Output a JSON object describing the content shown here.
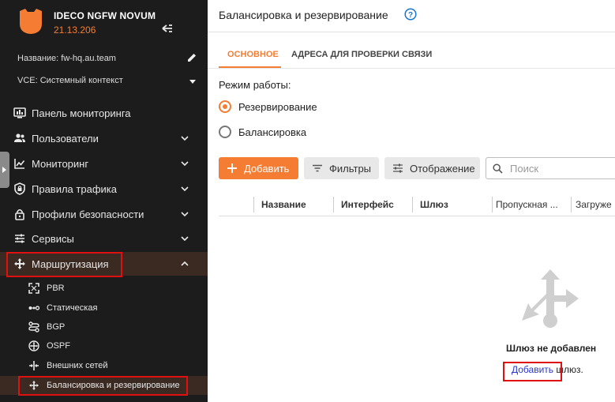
{
  "app": {
    "name": "IDECO NGFW NOVUM",
    "version": "21.13.206",
    "accent_color": "#f47d33",
    "sidebar_bg": "#1c1c1c"
  },
  "sidebar": {
    "name_label": "Название: fw-hq.au.team",
    "vce_label": "VCE: Системный контекст",
    "items": [
      {
        "label": "Панель мониторинга",
        "icon": "monitor-icon"
      },
      {
        "label": "Пользователи",
        "icon": "users-icon"
      },
      {
        "label": "Мониторинг",
        "icon": "chart-icon"
      },
      {
        "label": "Правила трафика",
        "icon": "shield-icon"
      },
      {
        "label": "Профили безопасности",
        "icon": "lock-icon"
      },
      {
        "label": "Сервисы",
        "icon": "sliders-icon"
      },
      {
        "label": "Маршрутизация",
        "icon": "routing-icon"
      }
    ],
    "sub_items": [
      {
        "label": "PBR",
        "icon": "pbr-icon"
      },
      {
        "label": "Статическая",
        "icon": "static-route-icon"
      },
      {
        "label": "BGP",
        "icon": "bgp-icon"
      },
      {
        "label": "OSPF",
        "icon": "ospf-icon"
      },
      {
        "label": "Внешних сетей",
        "icon": "external-networks-icon"
      },
      {
        "label": "Балансировка и резервирование",
        "icon": "balancing-icon"
      }
    ]
  },
  "header": {
    "title": "Балансировка и резервирование"
  },
  "tabs": [
    {
      "label": "ОСНОВНОЕ",
      "active": true
    },
    {
      "label": "АДРЕСА ДЛЯ ПРОВЕРКИ СВЯЗИ",
      "active": false
    }
  ],
  "mode": {
    "label": "Режим работы:",
    "options": [
      {
        "label": "Резервирование",
        "checked": true
      },
      {
        "label": "Балансировка",
        "checked": false
      }
    ]
  },
  "toolbar": {
    "add_label": "Добавить",
    "filters_label": "Фильтры",
    "display_label": "Отображение",
    "search_placeholder": "Поиск"
  },
  "table": {
    "columns": [
      "Название",
      "Интерфейс",
      "Шлюз",
      "Пропускная ...",
      "Загруже"
    ]
  },
  "empty_state": {
    "title": "Шлюз не добавлен",
    "link_label": "Добавить",
    "suffix": "шлюз."
  }
}
